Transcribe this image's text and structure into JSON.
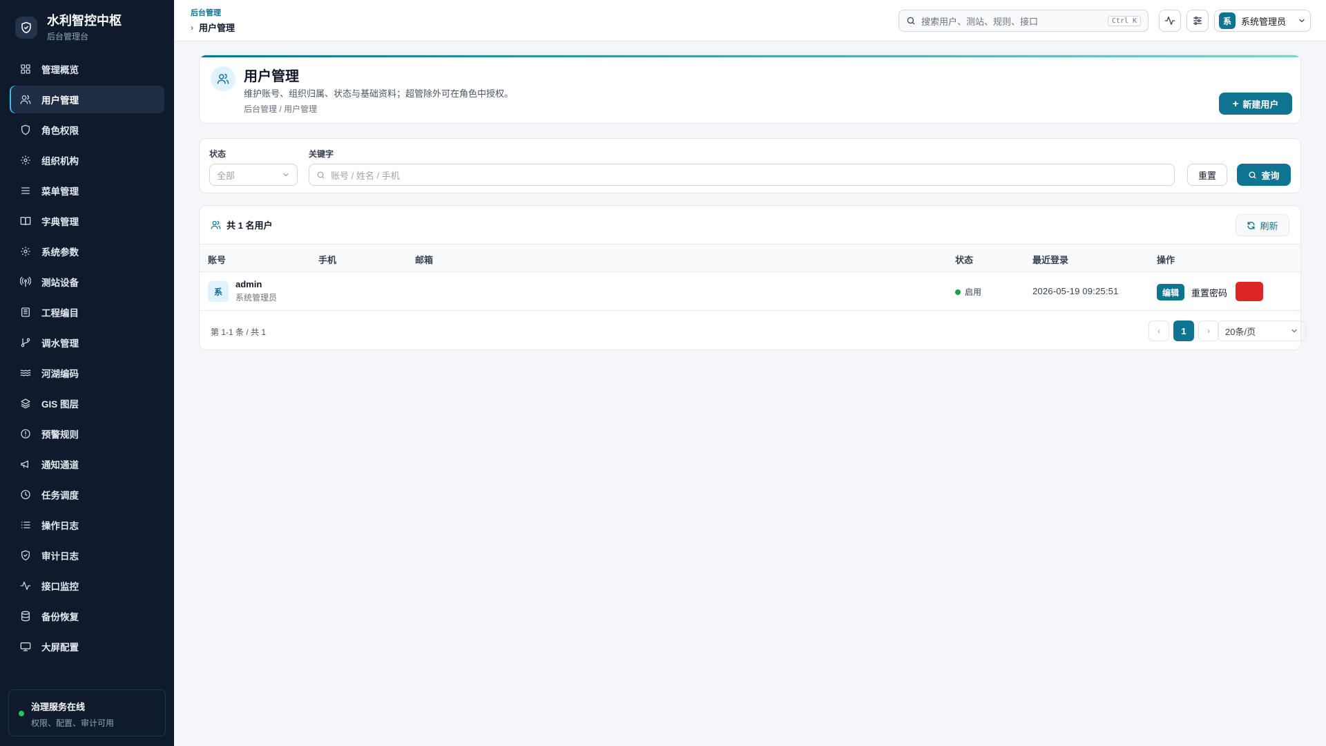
{
  "brand": {
    "title": "水利智控中枢",
    "subtitle": "后台管理台"
  },
  "sidebar": {
    "items": [
      {
        "label": "管理概览",
        "icon": "dashboard-icon"
      },
      {
        "label": "用户管理",
        "icon": "users-icon",
        "active": true
      },
      {
        "label": "角色权限",
        "icon": "shield-icon"
      },
      {
        "label": "组织机构",
        "icon": "gear-icon"
      },
      {
        "label": "菜单管理",
        "icon": "menu-icon"
      },
      {
        "label": "字典管理",
        "icon": "book-icon"
      },
      {
        "label": "系统参数",
        "icon": "settings-icon"
      },
      {
        "label": "测站设备",
        "icon": "radio-tower-icon"
      },
      {
        "label": "工程编目",
        "icon": "building-icon"
      },
      {
        "label": "调水管理",
        "icon": "git-branch-icon"
      },
      {
        "label": "河湖编码",
        "icon": "waves-icon"
      },
      {
        "label": "GIS 图层",
        "icon": "layers-icon"
      },
      {
        "label": "预警规则",
        "icon": "alert-circle-icon"
      },
      {
        "label": "通知通道",
        "icon": "megaphone-icon"
      },
      {
        "label": "任务调度",
        "icon": "clock-icon"
      },
      {
        "label": "操作日志",
        "icon": "list-icon"
      },
      {
        "label": "审计日志",
        "icon": "shield-check-icon"
      },
      {
        "label": "接口监控",
        "icon": "activity-icon"
      },
      {
        "label": "备份恢复",
        "icon": "database-icon"
      },
      {
        "label": "大屏配置",
        "icon": "monitor-icon"
      }
    ],
    "service": {
      "title": "治理服务在线",
      "subtitle": "权限、配置、审计可用",
      "status_color": "#22c55e"
    }
  },
  "topbar": {
    "breadcrumb_parent": "后台管理",
    "breadcrumb_current": "用户管理",
    "search_placeholder": "搜索用户、测站、规则、接口",
    "shortcut": "Ctrl K",
    "user_avatar": "系",
    "user_name": "系统管理员"
  },
  "hero": {
    "title": "用户管理",
    "description": "维护账号、组织归属、状态与基础资料；超管除外可在角色中授权。",
    "breadcrumb": "后台管理 / 用户管理",
    "new_button": "新建用户"
  },
  "filter": {
    "status_label": "状态",
    "status_value": "全部",
    "keyword_label": "关键字",
    "keyword_placeholder": "账号 / 姓名 / 手机",
    "reset_button": "重置",
    "query_button": "查询"
  },
  "table": {
    "count_title": "共 1 名用户",
    "refresh_button": "刷新",
    "columns": [
      "账号",
      "手机",
      "邮箱",
      "状态",
      "最近登录",
      "操作"
    ],
    "rows": [
      {
        "avatar": "系",
        "account": "admin",
        "name": "系统管理员",
        "phone": "",
        "email": "",
        "status": "启用",
        "last_login": "2026-05-19 09:25:51",
        "actions": {
          "edit": "编辑",
          "reset_password": "重置密码",
          "delete": ""
        }
      }
    ],
    "pager": {
      "info": "第 1-1 条 / 共 1",
      "current_page": "1",
      "page_size": "20条/页"
    }
  },
  "colors": {
    "accent": "#0e7490",
    "sidebar_bg": "#0f1b2d",
    "danger": "#dc2626",
    "success": "#16a34a"
  }
}
